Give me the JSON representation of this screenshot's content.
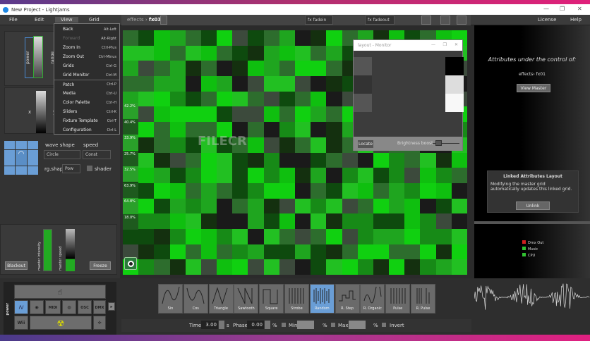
{
  "window": {
    "title": "New Project - Lightjams",
    "min": "—",
    "max": "❐",
    "close": "✕"
  },
  "menubar": {
    "file": "File",
    "edit": "Edit",
    "view": "View",
    "grid": "Grid",
    "license": "License",
    "help": "Help"
  },
  "toolbar": {
    "breadcrumb_prefix": "effects › ",
    "breadcrumb_current": "fx03",
    "fadein": "fx fadein",
    "fadeout": "fx fadeout"
  },
  "view_menu": [
    {
      "label": "Back",
      "shortcut": "Alt-Left",
      "enabled": true
    },
    {
      "label": "Forward",
      "shortcut": "Alt-Right",
      "enabled": false
    },
    {
      "label": "Zoom In",
      "shortcut": "Ctrl-Plus",
      "enabled": true
    },
    {
      "label": "Zoom Out",
      "shortcut": "Ctrl-Minus",
      "enabled": true
    },
    {
      "label": "Grids",
      "shortcut": "Ctrl-G",
      "enabled": true
    },
    {
      "label": "Grid Monitor",
      "shortcut": "Ctrl-M",
      "enabled": true
    },
    {
      "label": "Patch",
      "shortcut": "Ctrl-P",
      "enabled": true
    },
    {
      "label": "Media",
      "shortcut": "Ctrl-U",
      "enabled": true
    },
    {
      "label": "Color Palette",
      "shortcut": "Ctrl-H",
      "enabled": true
    },
    {
      "label": "Sliders",
      "shortcut": "Ctrl-K",
      "enabled": true
    },
    {
      "label": "Fixture Template",
      "shortcut": "Ctrl-T",
      "enabled": true
    },
    {
      "label": "Configuration",
      "shortcut": "Ctrl-L",
      "enabled": true
    }
  ],
  "left": {
    "power": "power",
    "range": "range",
    "x": "x",
    "y": "y",
    "wave_shape_label": "wave shape",
    "wave_shape": "Circle",
    "speed_label": "speed",
    "speed": "Const",
    "rg_shape_label": "rg.shape",
    "rg_shape": "Pow",
    "shader": "shader",
    "master_intensity": "master intensity",
    "master_speed": "master speed",
    "blackout": "Blackout",
    "freeze": "Freeze"
  },
  "grid_percents": [
    "42.2%",
    "40.4%",
    "33.9%",
    "25.7%",
    "32.5%",
    "63.9%",
    "64.8%",
    "18.0%"
  ],
  "monitor": {
    "title": "layout - Monitor",
    "locate": "Locate",
    "brightness_boost": "Brightness boost",
    "brightness_value": 0.1
  },
  "right": {
    "attr_title": "Attributes under the control of:",
    "attr_target": "effects› fx01",
    "view_master": "View Master",
    "linked_title": "Linked Attributes Layout",
    "linked_text": "Modifying the master grid automatically updates this linked grid.",
    "unlink": "Unlink",
    "status": [
      {
        "label": "Dmx Out",
        "color": "#d02020"
      },
      {
        "label": "Music",
        "color": "#30c030"
      },
      {
        "label": "CPU",
        "color": "#30c030"
      }
    ]
  },
  "sources": {
    "power": "power",
    "midi": "MIDI",
    "osc": "OSC",
    "dmx": "DMX",
    "wii": "Wii"
  },
  "waves": [
    "Sin",
    "Cos",
    "Triangle",
    "Sawtooth",
    "Square",
    "Strobe",
    "Random",
    "R. Step",
    "R. Organic",
    "Pulse",
    "R. Pulse"
  ],
  "selected_wave": "Random",
  "params": {
    "time_label": "Time",
    "time": "3.00",
    "time_unit": "s",
    "phase_label": "Phase",
    "phase": "0.00",
    "phase_unit": "%",
    "min_label": "Min",
    "min": "",
    "max_label": "Max",
    "max": "",
    "pct": "%",
    "invert": "Invert"
  },
  "watermark": "FILECR"
}
